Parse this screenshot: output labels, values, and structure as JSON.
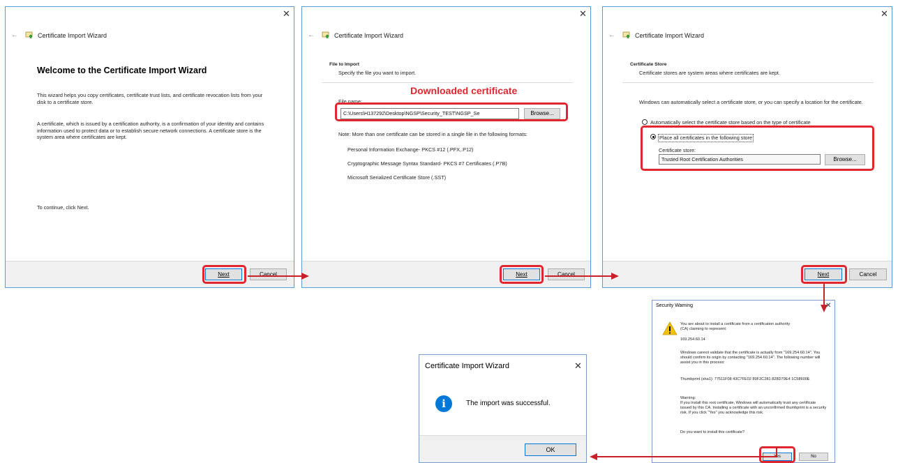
{
  "wizard_title": "Certificate Import Wizard",
  "buttons": {
    "next": "Next",
    "cancel": "Cancel",
    "browse": "Browse...",
    "yes": "Yes",
    "no": "No",
    "ok": "OK"
  },
  "step1": {
    "heading": "Welcome to the Certificate Import Wizard",
    "para1": "This wizard helps you copy certificates, certificate trust lists, and certificate revocation lists from your disk to a certificate store.",
    "para2": "A certificate, which is issued by a certification authority, is a confirmation of your identity and contains information used to protect data or to establish secure network connections. A certificate store is the system area where certificates are kept.",
    "continue": "To continue, click Next."
  },
  "step2": {
    "section_title": "File to Import",
    "section_sub": "Specify the file you want to import.",
    "annotation": "Downloaded certificate",
    "file_label": "File name:",
    "file_value": "C:\\Users\\H137292\\Desktop\\NGSP\\Security_TEST\\NGSP_Se",
    "note": "Note:  More than one certificate can be stored in a single file in the following formats:",
    "formats": [
      "Personal Information Exchange- PKCS #12 (.PFX,.P12)",
      "Cryptographic Message Syntax Standard- PKCS #7 Certificates (.P7B)",
      "Microsoft Serialized Certificate Store (.SST)"
    ]
  },
  "step3": {
    "section_title": "Certificate Store",
    "section_sub": "Certificate stores are system areas where certificates are kept.",
    "intro": "Windows can automatically select a certificate store, or you can specify a location for the certificate.",
    "option_auto": "Automatically select the certificate store based on the type of certificate",
    "option_place": "Place all certificates in the following store",
    "store_label": "Certificate store:",
    "store_value": "Trusted Root Certification Authorities"
  },
  "security": {
    "title": "Security Warning",
    "line1": "You are about to install a certificate from a certification authority (CA) claiming to represent:",
    "ip": "169.254.60.14",
    "line2": "Windows cannot validate that the certificate is actually from \"169.254.60.14\". You should confirm its origin by contacting \"169.254.60.14\". The following number will assist you in this process:",
    "thumbprint": "Thumbprint (sha1): 77511F08 43C7FE02 89F2C281 828D79E4 1C58600E",
    "warning_label": "Warning:",
    "warning": "If you install this root certificate, Windows will automatically trust any certificate issued by this CA. Installing a certificate with an unconfirmed thumbprint is a security risk. If you click \"Yes\" you acknowledge this risk.",
    "question": "Do you want to install this certificate?"
  },
  "success": {
    "title": "Certificate Import Wizard",
    "message": "The import was successful."
  },
  "colors": {
    "highlight": "#e0262f",
    "accent": "#0078d7",
    "info": "#0078d7",
    "warning": "#f2c200"
  }
}
